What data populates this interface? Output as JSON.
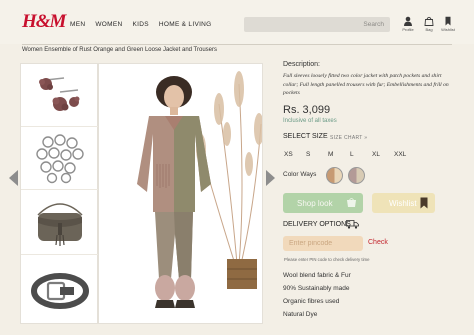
{
  "brand": {
    "logo_text": "H&M",
    "logo_color": "#c8102e"
  },
  "nav": {
    "items": [
      "MEN",
      "WOMEN",
      "KIDS",
      "HOME & LIVING"
    ]
  },
  "search": {
    "placeholder": "Search"
  },
  "header_icons": [
    {
      "icon": "profile-icon",
      "label": "Profile"
    },
    {
      "icon": "bag-icon",
      "label": "Bag"
    },
    {
      "icon": "wishlist-icon",
      "label": "Wishlist"
    }
  ],
  "product": {
    "title": "Women Ensemble of Rust Orange and Green Loose Jacket and Trousers",
    "description_label": "Description:",
    "description": "Full sleeves loosely fitted two color jacket with patch pockets and shirt collar; Full length panelled trousers with fur; Embellishments and frill on pockets",
    "price": "Rs. 3,099",
    "taxes": "Inclusive of all taxes",
    "select_size_label": "SELECT SIZE",
    "size_chart_label": "SIZE CHART »",
    "sizes": [
      "XS",
      "S",
      "M",
      "L",
      "XL",
      "XXL"
    ],
    "color_ways_label": "Color Ways",
    "color_ways": [
      "#c79a72",
      "#b39a97"
    ],
    "shop_look_label": "Shop look",
    "wishlist_label": "Wishlist",
    "delivery_label": "DELIVERY OPTIONS",
    "pincode_placeholder": "Enter pincode",
    "check_label": "Check",
    "pincode_note": "Please enter PIN code to check delivery time",
    "features": [
      "Wool blend fabric & Fur",
      "90% Sustainably made",
      "Organic fibres used",
      "Natural Dye"
    ]
  },
  "gallery": {
    "thumbnails": [
      "hair-clips",
      "rings",
      "crossbody-bag",
      "belt"
    ],
    "main_image": "model-wearing-ensemble"
  },
  "colors": {
    "accent_green": "#b2d3a8",
    "accent_yellow": "#efe3b8",
    "pin_field": "#f1d9bb",
    "check_red": "#c3262e",
    "taxes_green": "#6a9a86"
  }
}
